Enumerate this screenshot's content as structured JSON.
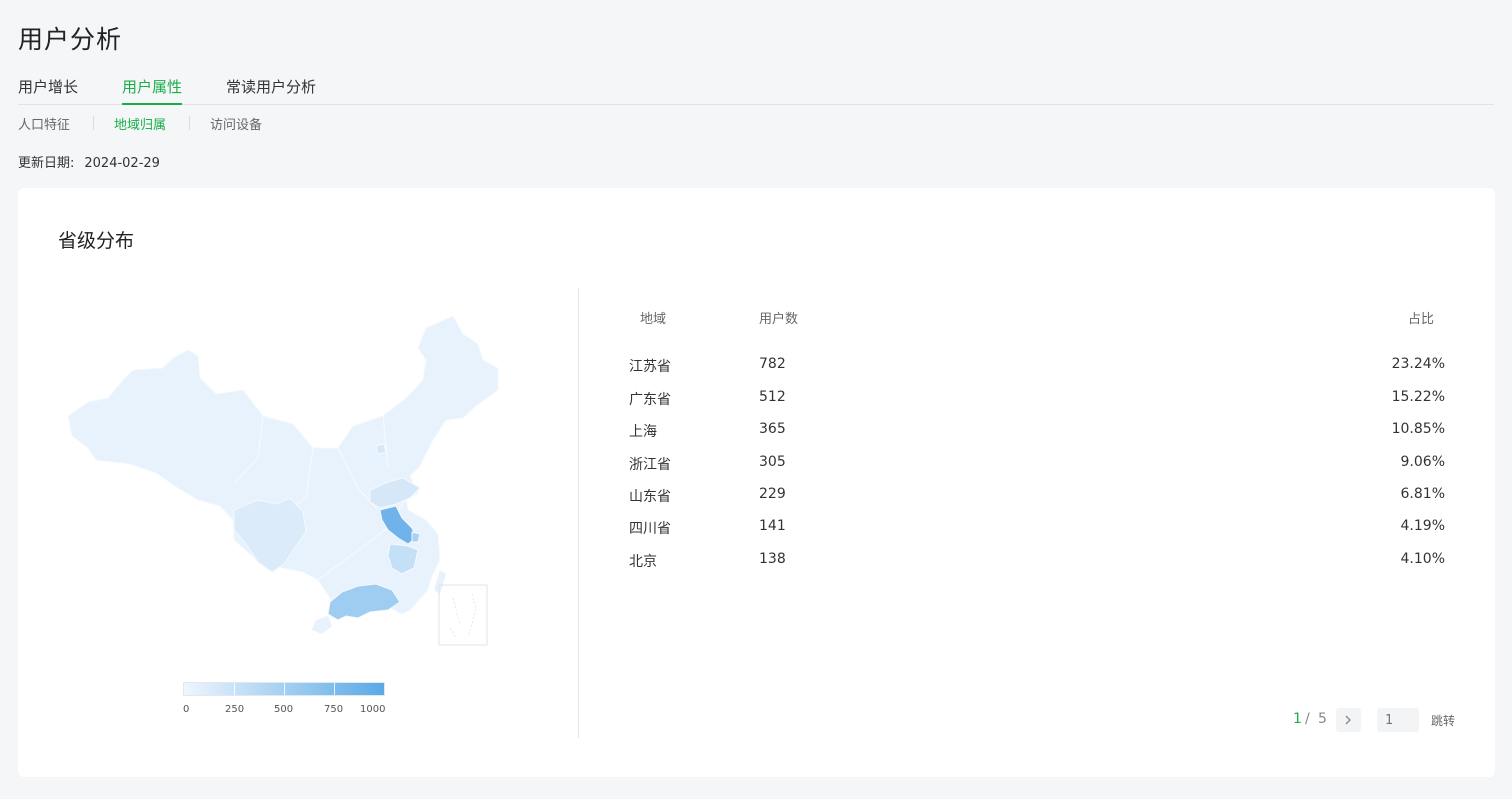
{
  "header": {
    "title": "用户分析"
  },
  "main_tabs": [
    {
      "label": "用户增长",
      "active": false
    },
    {
      "label": "用户属性",
      "active": true
    },
    {
      "label": "常读用户分析",
      "active": false
    }
  ],
  "sub_tabs": [
    {
      "label": "人口特征",
      "active": false
    },
    {
      "label": "地域归属",
      "active": true
    },
    {
      "label": "访问设备",
      "active": false
    }
  ],
  "update": {
    "label": "更新日期:",
    "date": "2024-02-29"
  },
  "card": {
    "title": "省级分布"
  },
  "legend": {
    "ticks": [
      "0",
      "250",
      "500",
      "750",
      "1000"
    ],
    "min_color": "#eef6fd",
    "max_color": "#5aa9e6"
  },
  "table": {
    "headers": {
      "region": "地域",
      "users": "用户数",
      "ratio": "占比"
    },
    "rows": [
      {
        "region": "江苏省",
        "users": "782",
        "ratio": "23.24%"
      },
      {
        "region": "广东省",
        "users": "512",
        "ratio": "15.22%"
      },
      {
        "region": "上海",
        "users": "365",
        "ratio": "10.85%"
      },
      {
        "region": "浙江省",
        "users": "305",
        "ratio": "9.06%"
      },
      {
        "region": "山东省",
        "users": "229",
        "ratio": "6.81%"
      },
      {
        "region": "四川省",
        "users": "141",
        "ratio": "4.19%"
      },
      {
        "region": "北京",
        "users": "138",
        "ratio": "4.10%"
      }
    ]
  },
  "pagination": {
    "current": "1",
    "separator": "/",
    "total": "5",
    "input_placeholder": "1",
    "jump_label": "跳转",
    "next_icon": "chevron-right-icon"
  },
  "colors": {
    "accent": "#1aad4a",
    "map_light": "#e8f2fc",
    "map_mid": "#bddcf6",
    "map_dark": "#6fb3ea"
  }
}
